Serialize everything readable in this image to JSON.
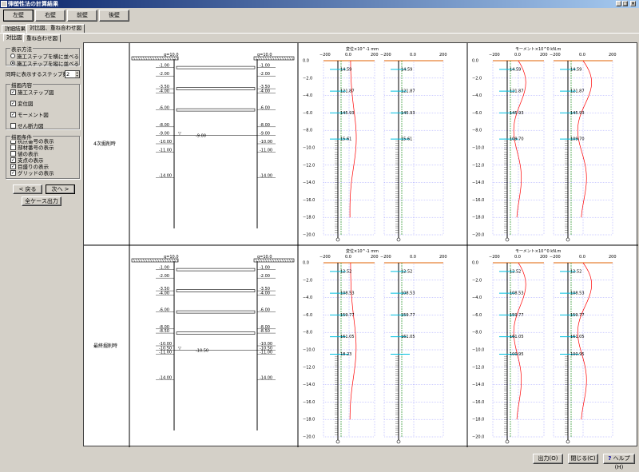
{
  "window": {
    "title": "弾塑性法の計算結果",
    "minimize_icon": "minimize-icon",
    "maximize_icon": "maximize-icon",
    "close_icon": "close-icon",
    "close_glyph": "×"
  },
  "wall_buttons": [
    "左壁",
    "右壁",
    "前壁",
    "後壁"
  ],
  "outer_tabs": [
    "詳細結果",
    "対比図、重ね合わせ図"
  ],
  "inner_tabs": [
    "対比図",
    "重ね合わせ図"
  ],
  "display_method": {
    "title": "表示方法",
    "options": [
      "施工ステップを横に並べる",
      "施工ステップを縦に並べる"
    ],
    "selected": 1
  },
  "steps": {
    "label": "同時に表示するステップ数",
    "value": "2"
  },
  "draw_content": {
    "title": "描画内容",
    "items": [
      {
        "label": "施工ステップ図",
        "checked": true
      },
      {
        "label": "変位図",
        "checked": true
      },
      {
        "label": "モーメント図",
        "checked": true
      },
      {
        "label": "せん断力図",
        "checked": false
      }
    ]
  },
  "draw_conditions": {
    "title": "描画条件",
    "items": [
      {
        "label": "杭点番号の表示",
        "checked": false
      },
      {
        "label": "部材番号の表示",
        "checked": false
      },
      {
        "label": "値の表示",
        "checked": false
      },
      {
        "label": "支点の表示",
        "checked": true
      },
      {
        "label": "目盛りの表示",
        "checked": true
      },
      {
        "label": "グリッドの表示",
        "checked": true
      }
    ]
  },
  "nav": {
    "prev": "< 戻る",
    "next": "次へ >",
    "all_cases": "全ケース出力"
  },
  "footer": {
    "output": "出力(O)",
    "close": "閉じる(C)",
    "help": "ヘルプ(H)",
    "help_icon": "help-icon",
    "help_glyph": "?"
  },
  "check_glyph": "✓",
  "rows": [
    {
      "label": "4次掘削時",
      "levels": [
        "-1.00",
        "-2.00",
        "-3.50",
        "-4.00",
        "-6.00",
        "-8.00",
        "-9.00",
        "-10.00",
        "-11.00",
        "-14.00"
      ],
      "strut_levels": [
        -1.0,
        -3.5,
        -6.0
      ],
      "excavation": -9.0,
      "exc_label": "-9.00",
      "disp": {
        "annotations": [
          "14.59",
          "121.87",
          "145.93",
          "15.61"
        ],
        "right_annotations": [
          "14.59",
          "121.87",
          "145.93",
          "15.61"
        ]
      },
      "mom": {
        "annotations": [
          "14.59",
          "121.87",
          "145.93",
          "109.70"
        ],
        "right_annotations": [
          "14.59",
          "121.87",
          "145.93",
          "109.70"
        ]
      }
    },
    {
      "label": "最終掘削時",
      "levels": [
        "-1.00",
        "-2.00",
        "-3.50",
        "-4.00",
        "-6.00",
        "-8.00",
        "-8.50",
        "-10.00",
        "-10.50",
        "-11.00",
        "-14.00"
      ],
      "strut_levels": [
        -1.0,
        -3.5,
        -6.0,
        -8.5
      ],
      "excavation": -10.5,
      "exc_label": "-10.50",
      "disp": {
        "annotations": [
          "12.52",
          "108.53",
          "159.77",
          "161.05",
          "18.23"
        ],
        "right_annotations": [
          "12.52",
          "108.53",
          "159.77",
          "161.05"
        ]
      },
      "mom": {
        "annotations": [
          "12.52",
          "108.53",
          "159.77",
          "161.05",
          "100.95"
        ],
        "right_annotations": [
          "12.52",
          "108.53",
          "159.77",
          "161.05",
          "100.95"
        ]
      }
    }
  ],
  "surcharge_label": "q=10.0",
  "chart_data": [
    {
      "type": "line",
      "title": "変位×10^-1 mm",
      "x_ticks": [
        -200,
        0,
        200
      ],
      "x_tick_labels": [
        "−200",
        "0.0",
        "200"
      ],
      "y_ticks": [
        0,
        -2,
        -4,
        -6,
        -8,
        -10,
        -12,
        -14,
        -16,
        -18,
        -20
      ],
      "y_tick_labels": [
        "0.0",
        "−2.0",
        "−4.0",
        "−6.0",
        "−8.0",
        "−10.0",
        "−12.0",
        "−14.0",
        "−16.0",
        "−18.0",
        "−20.0"
      ],
      "ylim": [
        -20,
        0
      ]
    },
    {
      "type": "line",
      "title": "モーメント×10^0 kN.m",
      "x_ticks": [
        -200,
        0,
        200
      ],
      "x_tick_labels": [
        "−200",
        "0.0",
        "200"
      ],
      "y_ticks": [
        0,
        -2,
        -4,
        -6,
        -8,
        -10,
        -12,
        -14,
        -16,
        -18,
        -20
      ],
      "y_tick_labels": [
        "0.0",
        "−2.0",
        "−4.0",
        "−6.0",
        "−8.0",
        "−10.0",
        "−12.0",
        "−14.0",
        "−16.0",
        "−18.0",
        "−20.0"
      ],
      "ylim": [
        -20,
        0
      ]
    }
  ]
}
